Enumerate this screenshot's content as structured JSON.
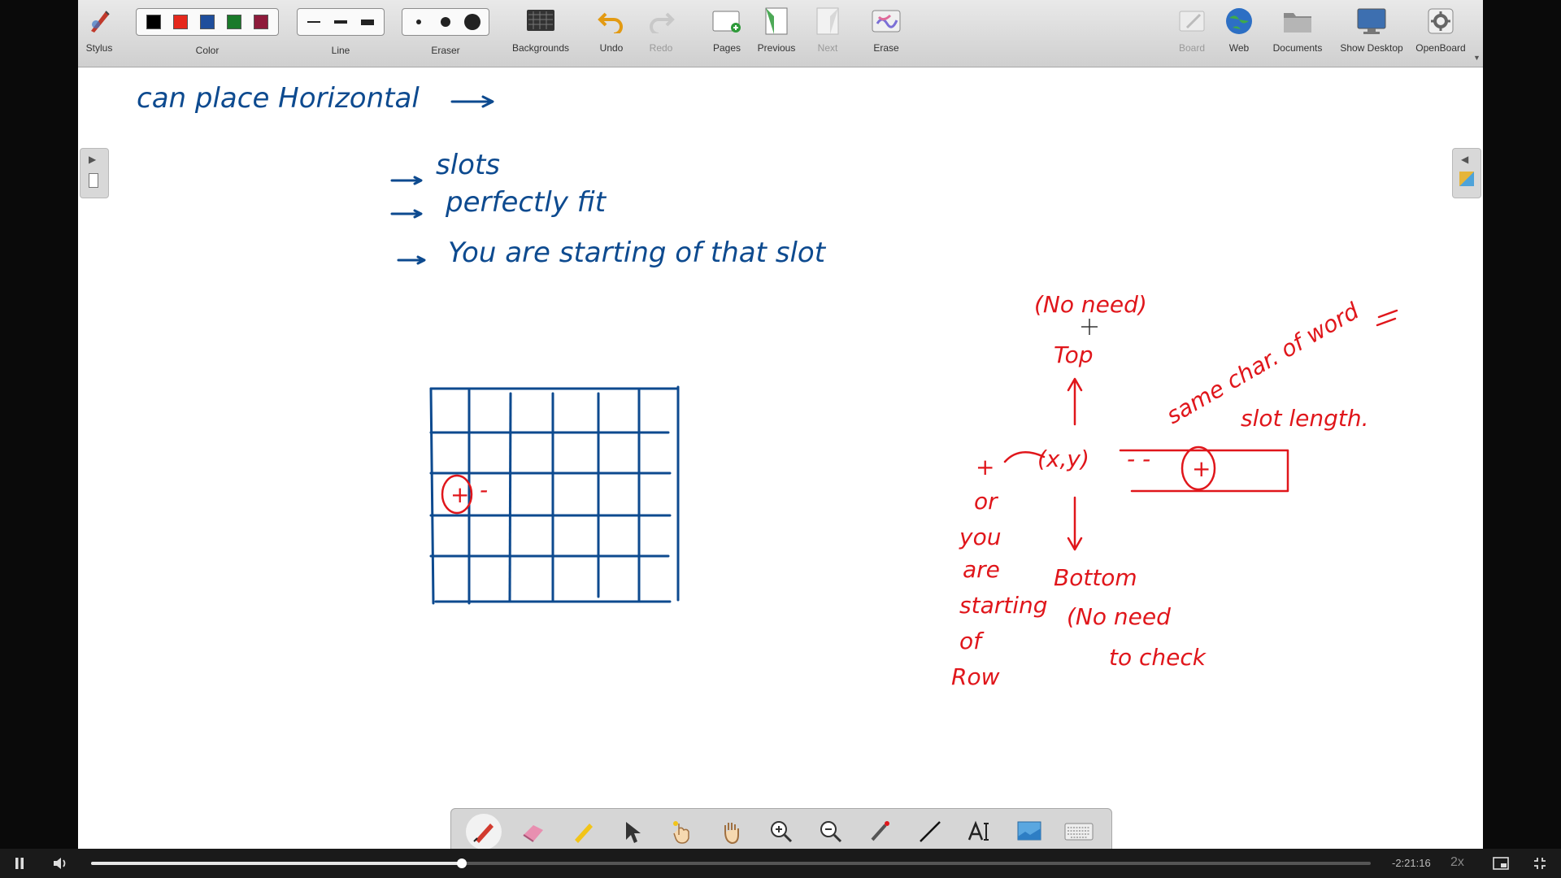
{
  "toolbar": {
    "stylus_label": "Stylus",
    "color_label": "Color",
    "line_label": "Line",
    "eraser_label": "Eraser",
    "backgrounds_label": "Backgrounds",
    "undo_label": "Undo",
    "redo_label": "Redo",
    "pages_label": "Pages",
    "previous_label": "Previous",
    "next_label": "Next",
    "erase_label": "Erase",
    "board_label": "Board",
    "web_label": "Web",
    "documents_label": "Documents",
    "show_desktop_label": "Show Desktop",
    "openboard_label": "OpenBoard",
    "colors": [
      "#000000",
      "#e5281c",
      "#1f4e9c",
      "#1a7a2a",
      "#8e1b3b"
    ]
  },
  "board": {
    "heading": "can place Horizontal",
    "bullets": [
      "slots",
      "perfectly fit",
      "You are starting of that slot"
    ],
    "note_top_no_need": "(No need)",
    "label_top": "Top",
    "point": "(x,y)",
    "plus": "+",
    "label_bottom": "Bottom",
    "note_bottom_line1": "(No need",
    "note_bottom_line2": "to check",
    "same_char_line1": "same char. of word",
    "same_char_line2": "slot length.",
    "left_note": [
      "+",
      "or",
      "you",
      "are",
      "starting",
      "of",
      "Row"
    ],
    "grid_mark_plus": "+",
    "grid_mark_minus": "-",
    "point_dashes": "- -"
  },
  "player": {
    "time_remaining": "-2:21:16",
    "speed": "2x",
    "progress": 0.29
  }
}
